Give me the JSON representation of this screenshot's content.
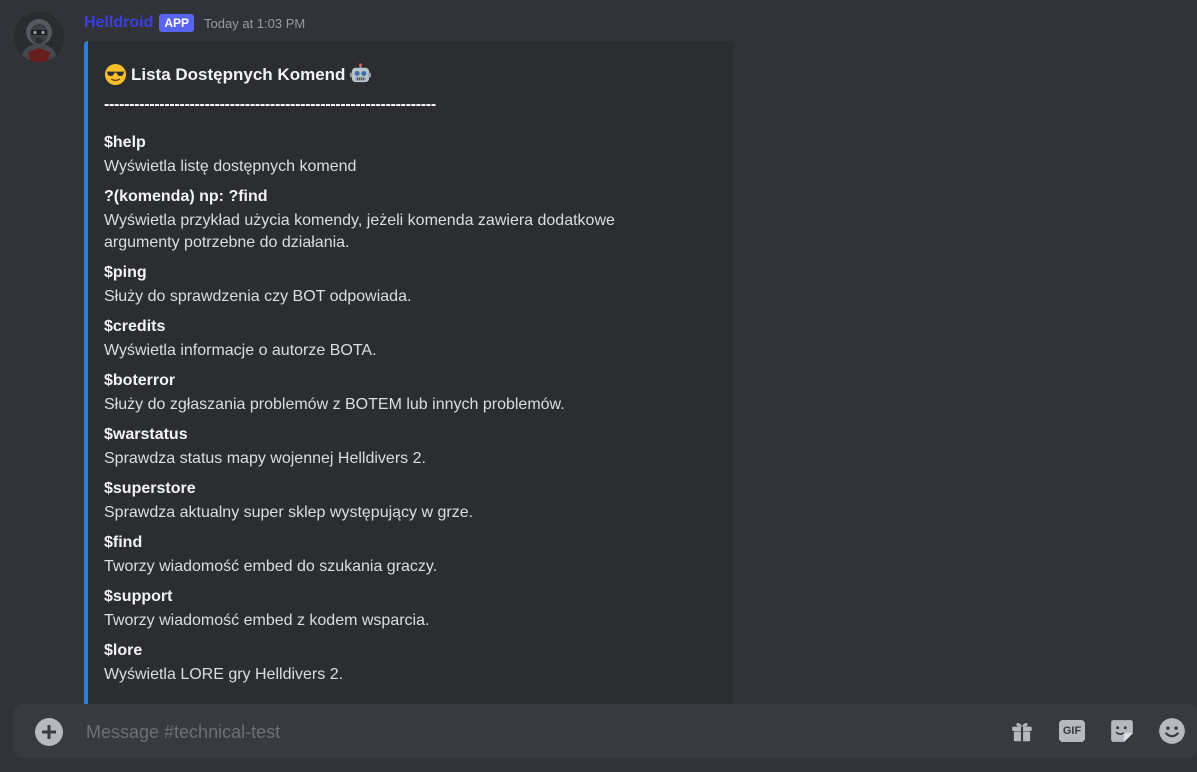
{
  "message": {
    "username": "Helldroid",
    "badge": "APP",
    "timestamp": "Today at 1:03 PM"
  },
  "embed": {
    "title": "Lista Dostępnych Komend",
    "title_icon_left": "sunglasses-emoji-icon",
    "title_icon_right": "robot-emoji-icon",
    "separator": "------------------------------------------------------------------",
    "accent_color": "#2b7fdc",
    "fields": [
      {
        "name": "$help",
        "value": "Wyświetla listę dostępnych komend"
      },
      {
        "name": "?(komenda) np: ?find",
        "value": "Wyświetla przykład użycia komendy, jeżeli komenda zawiera dodatkowe argumenty potrzebne do działania."
      },
      {
        "name": "$ping",
        "value": "Służy do sprawdzenia czy BOT odpowiada."
      },
      {
        "name": "$credits",
        "value": "Wyświetla informacje o autorze BOTA."
      },
      {
        "name": "$boterror",
        "value": "Służy do zgłaszania problemów z BOTEM lub innych problemów."
      },
      {
        "name": "$warstatus",
        "value": "Sprawdza status mapy wojennej Helldivers 2."
      },
      {
        "name": "$superstore",
        "value": "Sprawdza aktualny super sklep występujący w grze."
      },
      {
        "name": "$find",
        "value": "Tworzy wiadomość embed do szukania graczy."
      },
      {
        "name": "$support",
        "value": "Tworzy wiadomość embed z kodem wsparcia."
      },
      {
        "name": "$lore",
        "value": "Wyświetla LORE gry Helldivers 2."
      }
    ]
  },
  "composer": {
    "placeholder": "Message #technical-test",
    "gif_label": "GIF",
    "icons": [
      "plus-circle-icon",
      "gift-icon",
      "gif-icon",
      "sticker-icon",
      "emoji-icon"
    ]
  },
  "colors": {
    "background": "#313338",
    "embed_background": "#2b2d31",
    "username": "#3a3fe0",
    "badge": "#5865f2"
  }
}
